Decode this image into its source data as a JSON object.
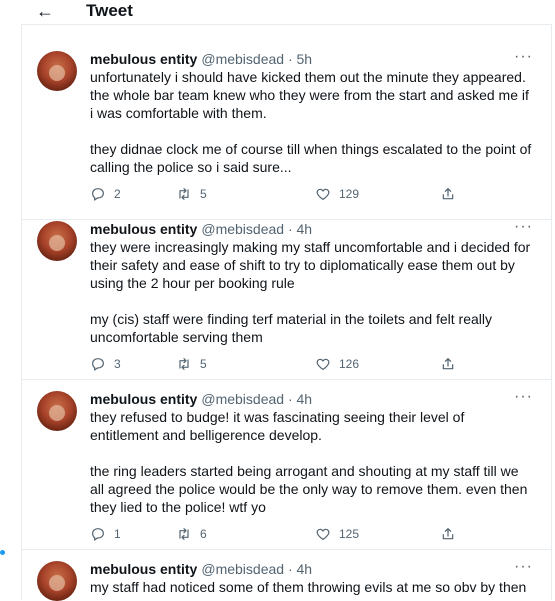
{
  "header": {
    "title": "Tweet"
  },
  "tweets": [
    {
      "name": "mebulous entity",
      "handle": "@mebisdead · 5h",
      "paragraphs": [
        "unfortunately i should have kicked them out the minute they appeared. the whole bar team knew who they were from the start and asked me if i was comfortable with them.",
        "they didnae clock me of course till when things escalated to the point of calling the police so i said sure..."
      ],
      "replies": "2",
      "retweets": "5",
      "likes": "129"
    },
    {
      "name": "mebulous entity",
      "handle": "@mebisdead · 4h",
      "paragraphs": [
        "they were increasingly making my staff uncomfortable and i decided for their safety and ease of shift to try to diplomatically ease them out by using the 2 hour per booking rule",
        "my (cis) staff were finding terf material in the toilets and felt really uncomfortable serving them"
      ],
      "replies": "3",
      "retweets": "5",
      "likes": "126"
    },
    {
      "name": "mebulous entity",
      "handle": "@mebisdead · 4h",
      "paragraphs": [
        "they refused to budge! it was fascinating seeing their level of entitlement and belligerence develop.",
        "the ring leaders started being arrogant and shouting at my staff till we all agreed the police would be the only way to remove them. even then they lied to the police! wtf yo"
      ],
      "replies": "1",
      "retweets": "6",
      "likes": "125"
    },
    {
      "name": "mebulous entity",
      "handle": "@mebisdead · 4h",
      "paragraphs": [
        "my staff had noticed some of them throwing evils at me so obv by then"
      ]
    }
  ],
  "icons": {
    "back": "arrow-left-icon",
    "more": "more-dots-icon",
    "reply": "reply-icon",
    "retweet": "retweet-icon",
    "like": "heart-icon",
    "share": "share-icon"
  },
  "colors": {
    "text": "#0f1419",
    "secondary": "#536471",
    "border": "#e6ecf0",
    "accent": "#1d9bf0"
  }
}
